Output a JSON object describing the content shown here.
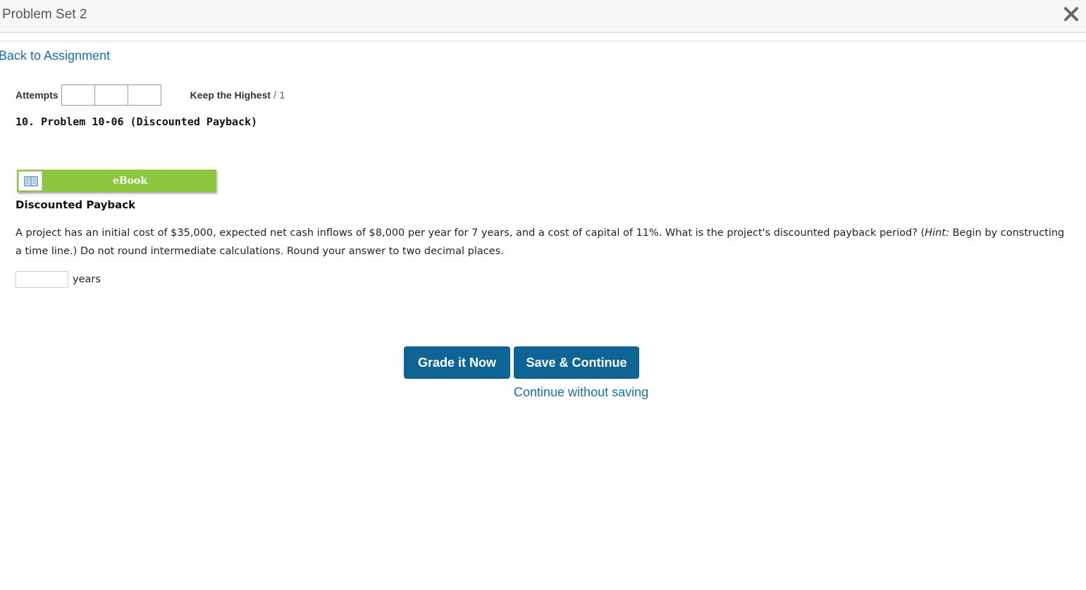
{
  "header": {
    "title": "Problem Set 2",
    "close_icon": "close-icon"
  },
  "nav": {
    "back_label": "Back to Assignment"
  },
  "attempts": {
    "label": "Attempts",
    "boxes": [
      "",
      "",
      ""
    ],
    "keep_label": "Keep the Highest",
    "keep_value": "/ 1"
  },
  "problem": {
    "title": "10.  Problem 10-06 (Discounted Payback)",
    "ebook_label": "eBook",
    "ebook_icon": "book-icon",
    "heading": "Discounted Payback",
    "question_part1": "A project has an initial cost of $35,000, expected net cash inflows of $8,000 per year for 7 years, and a cost of capital of 11%. What is the project's discounted payback period? (",
    "question_hint": "Hint:",
    "question_part2": " Begin by constructing a time line.) Do not round intermediate calculations. Round your answer to two decimal places.",
    "answer_value": "",
    "answer_units": "years"
  },
  "actions": {
    "grade_label": "Grade it Now",
    "save_label": "Save & Continue",
    "continue_label": "Continue without saving"
  },
  "colors": {
    "primary_button": "#0f6496",
    "link": "#1a6ea8",
    "ebook_bar": "#8dc63f"
  }
}
